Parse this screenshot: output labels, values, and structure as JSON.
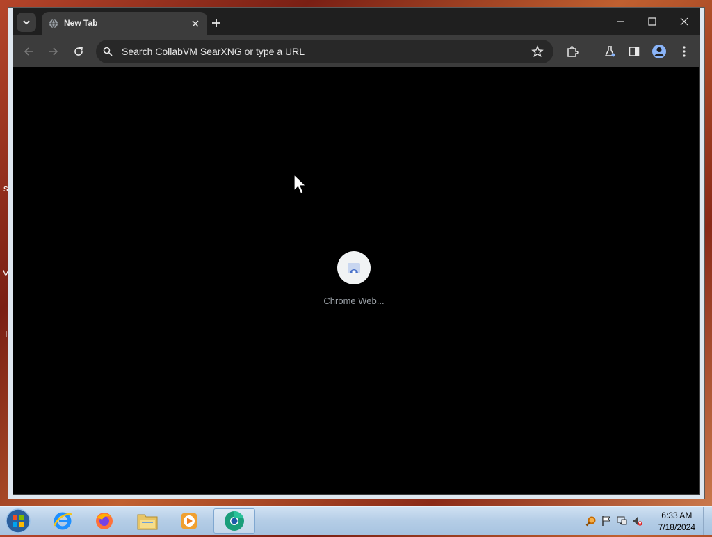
{
  "browser": {
    "tab": {
      "title": "New Tab"
    },
    "omnibox": {
      "placeholder": "Search CollabVM SearXNG or type a URL"
    }
  },
  "content": {
    "shortcut": {
      "label": "Chrome Web..."
    }
  },
  "taskbar": {
    "clock": {
      "time": "6:33 AM",
      "date": "7/18/2024"
    },
    "apps": [
      "internet-explorer",
      "firefox",
      "file-explorer",
      "media-player",
      "chrome"
    ]
  },
  "desktop": {
    "edge_letters": [
      "s",
      "V",
      "I"
    ]
  }
}
